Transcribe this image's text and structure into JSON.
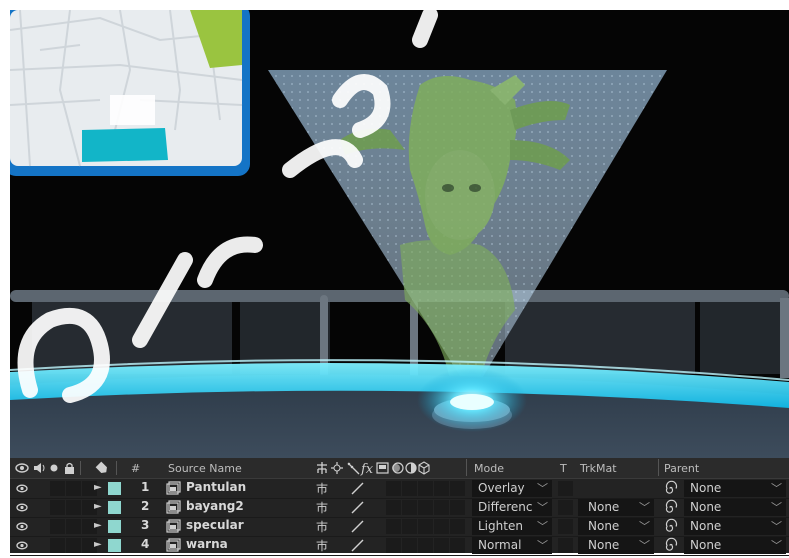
{
  "colors": {
    "neon": "#22d0f0",
    "map_green": "#9ac440",
    "map_cyan": "#12b5c8",
    "label_swatch": "#8fd7cf",
    "panel_bg": "#232323",
    "hologram": "#a9c7e0"
  },
  "timeline": {
    "columns": {
      "number": "#",
      "source_name": "Source Name",
      "mode": "Mode",
      "t": "T",
      "trkmat": "TrkMat",
      "parent": "Parent"
    },
    "header_icons": [
      "eye-icon",
      "audio-icon",
      "solo-icon",
      "lock-icon",
      "label-tag-icon",
      "shy-icon",
      "collapse-icon",
      "quality-icon",
      "fx-icon",
      "frame-blend-icon",
      "motion-blur-icon",
      "adjustment-icon",
      "3d-layer-icon"
    ],
    "layers": [
      {
        "number": "1",
        "name": "Pantulan",
        "mode": "Overlay",
        "trkmat": "",
        "parent": "None"
      },
      {
        "number": "2",
        "name": "bayang2",
        "mode": "Differenc",
        "trkmat": "None",
        "parent": "None"
      },
      {
        "number": "3",
        "name": "specular",
        "mode": "Lighten",
        "trkmat": "None",
        "parent": "None"
      },
      {
        "number": "4",
        "name": "warna",
        "mode": "Normal",
        "trkmat": "None",
        "parent": "None"
      }
    ]
  }
}
